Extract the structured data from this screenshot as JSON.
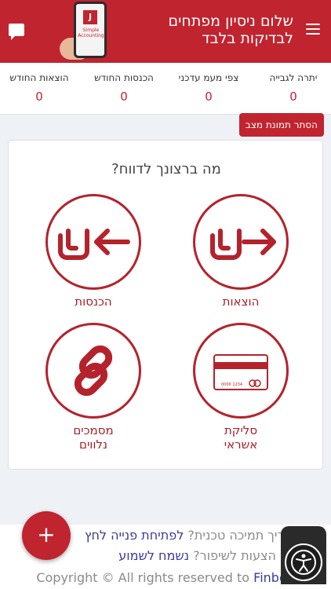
{
  "header": {
    "title": "שלום ניסיון מפתחים לבדיקות בלבד",
    "logo_text": "Simple Accounting",
    "logo_badge": "J"
  },
  "stats": [
    {
      "label": "יתרה לגבייה",
      "value": "0"
    },
    {
      "label": "צפי מעמ עדכני",
      "value": "0"
    },
    {
      "label": "הכנסות החודש",
      "value": "0"
    },
    {
      "label": "הוצאות החודש",
      "value": "0"
    }
  ],
  "hide_snapshot_label": "הסתר תמונת מצב",
  "card": {
    "title": "מה ברצונך לדווח?",
    "tiles": {
      "expenses": "הוצאות",
      "income": "הכנסות",
      "credit_line1": "סליקת",
      "credit_line2": "אשראי",
      "docs_line1": "מסמכים",
      "docs_line2": "נלווים"
    },
    "card_digits": "0000 1234"
  },
  "footer": {
    "line1_text": "צריך תמיכה טכנית?",
    "line1_link": "לפתיחת פנייה לחץ",
    "line2_text": "יש הצעות לשיפור?",
    "line2_link": "נשמח לשמוע",
    "copyright": "Copyright © All rights reserved to",
    "brand": "Finbot"
  },
  "fab_label": "+",
  "colors": {
    "accent": "#c0242f",
    "link": "#3a3a9a"
  },
  "icons": [
    "hamburger-icon",
    "chat-icon",
    "arrow-right-shekel-icon",
    "arrow-left-shekel-icon",
    "credit-card-icon",
    "link-icon",
    "plus-icon",
    "accessibility-icon"
  ]
}
